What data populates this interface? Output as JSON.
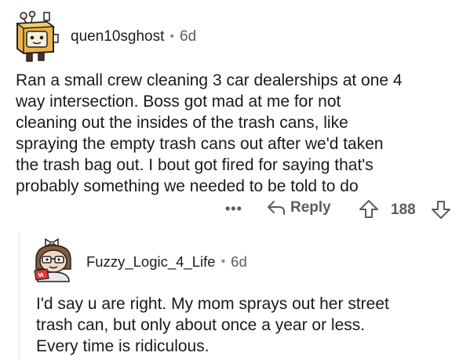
{
  "comments": [
    {
      "username": "quen10sghost",
      "separator": "•",
      "age": "6d",
      "body_lines": [
        "Ran a small crew cleaning 3 car dealerships at one 4",
        "way intersection. Boss got mad at me for not",
        "cleaning out the insides of the trash cans, like",
        "spraying the empty trash cans out after we'd taken",
        "the trash bag out. I bout got fired for saying that's",
        "probably something we needed to be told to do"
      ],
      "actions": {
        "more_label": "•••",
        "reply_label": "Reply",
        "score": "188"
      },
      "icons": {
        "reply": "reply-arrow-icon",
        "upvote": "upvote-arrow-icon",
        "downvote": "downvote-arrow-icon",
        "more": "more-options-icon"
      }
    },
    {
      "username": "Fuzzy_Logic_4_Life",
      "separator": "•",
      "age": "6d",
      "body_lines": [
        "I'd say u are right. My mom sprays out her street",
        "trash can, but only about once a year or less.",
        "Every time is ridiculous."
      ]
    }
  ],
  "colors": {
    "text": "#1a1a1b",
    "meta": "#5c5c5c",
    "icon": "#5c5c5c",
    "thread": "#edeff1"
  }
}
